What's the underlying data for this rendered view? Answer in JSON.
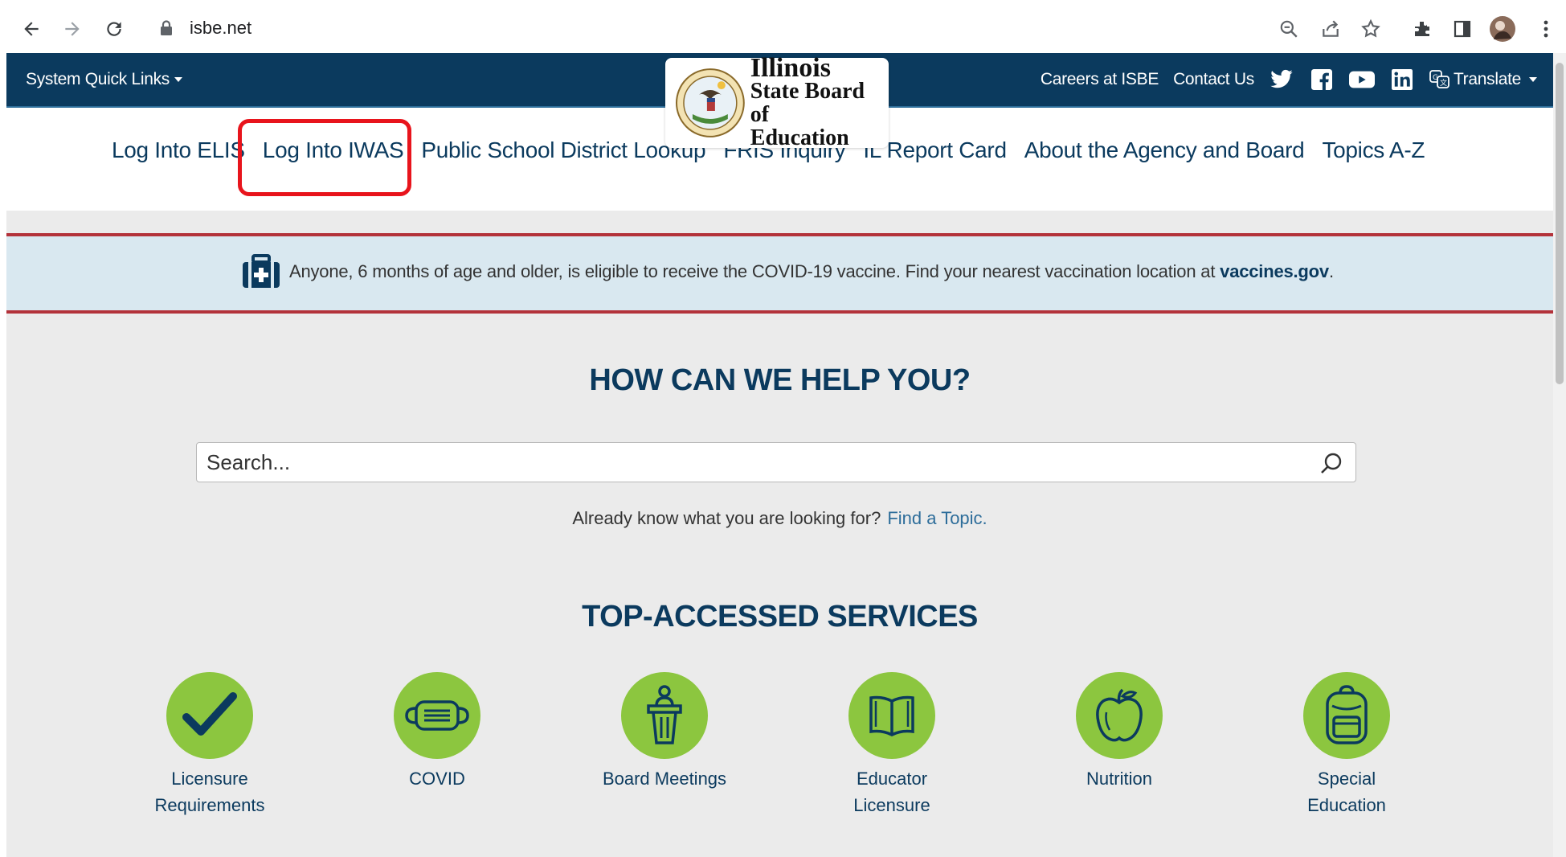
{
  "browser": {
    "url": "isbe.net"
  },
  "topbar": {
    "quick_links_label": "System Quick Links",
    "careers_label": "Careers at ISBE",
    "contact_label": "Contact Us",
    "translate_label": "Translate",
    "social_icons": [
      "twitter-icon",
      "facebook-icon",
      "youtube-icon",
      "linkedin-icon"
    ]
  },
  "logo": {
    "line1": "Illinois",
    "line2": "State Board of",
    "line3": "Education"
  },
  "nav": {
    "items": [
      {
        "label": "Log Into ELIS"
      },
      {
        "label": "Log Into IWAS"
      },
      {
        "label": "Public School District Lookup"
      },
      {
        "label": "FRIS Inquiry"
      },
      {
        "label": "IL Report Card"
      },
      {
        "label": "About the Agency and Board"
      },
      {
        "label": "Topics A-Z"
      }
    ],
    "highlighted_item": "Log Into IWAS",
    "highlight_color": "#e8141c"
  },
  "alert": {
    "text": "Anyone, 6 months of age and older, is eligible to receive the COVID-19 vaccine. Find your nearest vaccination location at ",
    "link": "vaccines.gov",
    "trailing": "."
  },
  "help": {
    "title": "HOW CAN WE HELP YOU?",
    "search_placeholder": "Search...",
    "already_text": "Already know what you are looking for?",
    "find_topic_link": "Find a Topic."
  },
  "services": {
    "title": "TOP-ACCESSED SERVICES",
    "items": [
      {
        "line1": "Licensure",
        "line2": "Requirements",
        "icon": "checkmark-icon"
      },
      {
        "line1": "COVID",
        "line2": "",
        "icon": "face-mask-icon"
      },
      {
        "line1": "Board Meetings",
        "line2": "",
        "icon": "podium-icon"
      },
      {
        "line1": "Educator",
        "line2": "Licensure",
        "icon": "book-icon"
      },
      {
        "line1": "Nutrition",
        "line2": "",
        "icon": "apple-icon"
      },
      {
        "line1": "Special",
        "line2": "Education",
        "icon": "backpack-icon"
      }
    ]
  },
  "colors": {
    "brand_navy": "#0b3a5e",
    "accent_green": "#8cc63f",
    "alert_red": "#b3323a",
    "alert_bg": "#d9e8f0"
  }
}
